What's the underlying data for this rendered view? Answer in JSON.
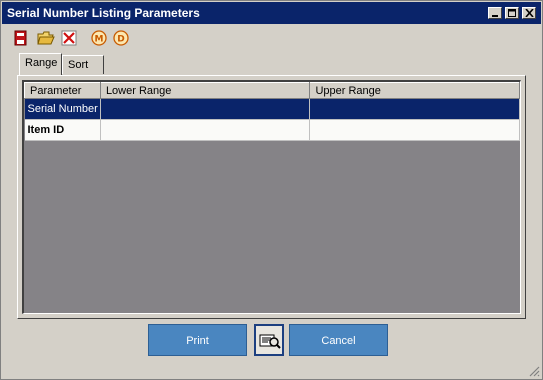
{
  "window": {
    "title": "Serial Number Listing Parameters",
    "controls": [
      "minimize-icon",
      "maximize-icon",
      "close-icon"
    ]
  },
  "toolbar": {
    "icons": [
      "save-icon",
      "open-folder-icon",
      "delete-icon",
      "m-circle-icon",
      "d-circle-icon"
    ]
  },
  "tabs": [
    {
      "label": "Range",
      "active": true
    },
    {
      "label": "Sort",
      "active": false
    }
  ],
  "grid": {
    "columns": [
      "Parameter",
      "Lower Range",
      "Upper Range"
    ],
    "rows": [
      {
        "parameter": "Serial Number",
        "lower": "",
        "upper": "",
        "selected": true,
        "bold": false
      },
      {
        "parameter": "Item ID",
        "lower": "",
        "upper": "",
        "selected": false,
        "bold": true
      }
    ]
  },
  "buttons": {
    "print_label": "Print",
    "cancel_label": "Cancel",
    "preview_icon": "print-preview-icon"
  },
  "colors": {
    "titlebar": "#0a246a",
    "selection": "#0a246a",
    "grid_background": "#858387",
    "button": "#4a86c0"
  }
}
